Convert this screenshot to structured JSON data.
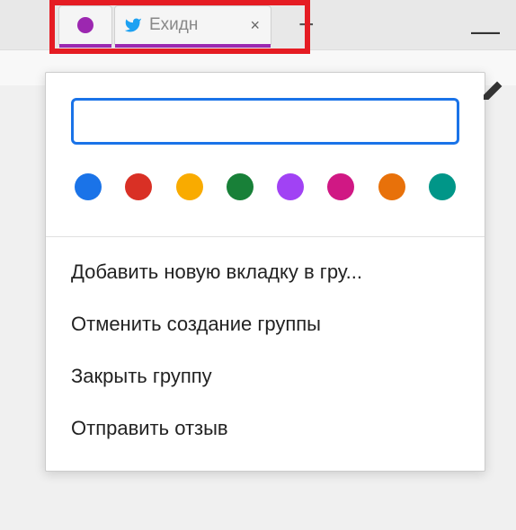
{
  "tabs": {
    "tab2_title": "Ехидн",
    "close_glyph": "×",
    "new_tab_glyph": "+",
    "minimize_glyph": "—"
  },
  "popup": {
    "name_value": "",
    "colors": [
      "#1a73e8",
      "#d93025",
      "#f9ab00",
      "#188038",
      "#a142f4",
      "#d01884",
      "#e8710a",
      "#009688"
    ],
    "menu": {
      "add_tab": "Добавить новую вкладку в гру...",
      "cancel": "Отменить создание группы",
      "close_group": "Закрыть группу",
      "feedback": "Отправить отзыв"
    }
  }
}
